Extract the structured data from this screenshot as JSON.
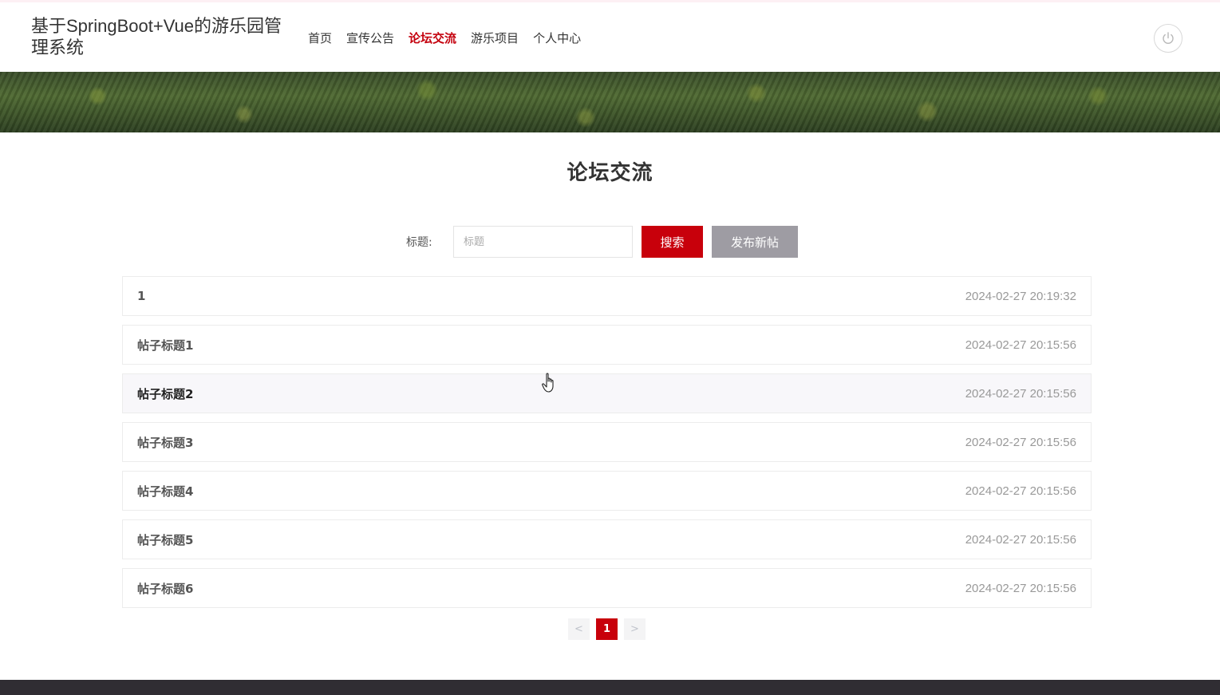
{
  "header": {
    "brand": "基于SpringBoot+Vue的游乐园管理系统",
    "nav": [
      {
        "label": "首页",
        "active": false
      },
      {
        "label": "宣传公告",
        "active": false
      },
      {
        "label": "论坛交流",
        "active": true
      },
      {
        "label": "游乐项目",
        "active": false
      },
      {
        "label": "个人中心",
        "active": false
      }
    ],
    "power_icon": "power-icon"
  },
  "main": {
    "title": "论坛交流",
    "search": {
      "label": "标题:",
      "placeholder": "标题",
      "value": "",
      "search_button": "搜索",
      "new_post_button": "发布新帖"
    },
    "posts": [
      {
        "title": "1",
        "time": "2024-02-27 20:19:32"
      },
      {
        "title": "帖子标题1",
        "time": "2024-02-27 20:15:56"
      },
      {
        "title": "帖子标题2",
        "time": "2024-02-27 20:15:56"
      },
      {
        "title": "帖子标题3",
        "time": "2024-02-27 20:15:56"
      },
      {
        "title": "帖子标题4",
        "time": "2024-02-27 20:15:56"
      },
      {
        "title": "帖子标题5",
        "time": "2024-02-27 20:15:56"
      },
      {
        "title": "帖子标题6",
        "time": "2024-02-27 20:15:56"
      }
    ],
    "pagination": {
      "prev": "<",
      "current": "1",
      "next": ">"
    }
  },
  "colors": {
    "accent": "#c8000b",
    "secondary_button": "#9e9ca3",
    "footer": "#302d33"
  }
}
